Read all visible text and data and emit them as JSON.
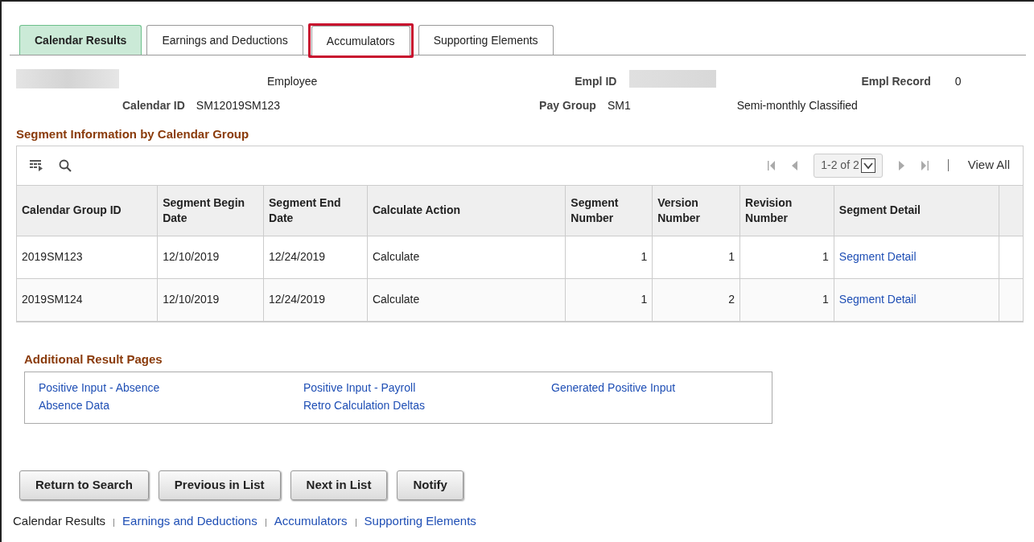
{
  "tabs": [
    {
      "label": "Calendar Results",
      "selected": true,
      "highlighted": false
    },
    {
      "label": "Earnings and Deductions",
      "selected": false,
      "highlighted": false
    },
    {
      "label": "Accumulators",
      "selected": false,
      "highlighted": true
    },
    {
      "label": "Supporting Elements",
      "selected": false,
      "highlighted": false
    }
  ],
  "header": {
    "employee_label": "Employee",
    "empl_id_label": "Empl ID",
    "empl_record_label": "Empl Record",
    "empl_record": "0",
    "calendar_id_label": "Calendar ID",
    "calendar_id": "SM12019SM123",
    "pay_group_label": "Pay Group",
    "pay_group": "SM1",
    "pay_group_description": "Semi-monthly Classified"
  },
  "segment_grid": {
    "title": "Segment Information by Calendar Group",
    "pager": "1-2 of 2",
    "view_all": "View All",
    "columns": [
      "Calendar Group ID",
      "Segment Begin Date",
      "Segment End Date",
      "Calculate Action",
      "Segment Number",
      "Version Number",
      "Revision Number",
      "Segment Detail"
    ],
    "rows": [
      {
        "cells": [
          "2019SM123",
          "12/10/2019",
          "12/24/2019",
          "Calculate",
          "1",
          "1",
          "1",
          "Segment Detail"
        ]
      },
      {
        "cells": [
          "2019SM124",
          "12/10/2019",
          "12/24/2019",
          "Calculate",
          "1",
          "2",
          "1",
          "Segment Detail"
        ]
      }
    ]
  },
  "additional_pages": {
    "title": "Additional Result Pages",
    "links": [
      [
        "Positive Input - Absence",
        "Absence Data"
      ],
      [
        "Positive Input - Payroll",
        "Retro Calculation Deltas"
      ],
      [
        "Generated Positive Input"
      ]
    ]
  },
  "buttons": [
    "Return to Search",
    "Previous in List",
    "Next in List",
    "Notify"
  ],
  "footer_links": [
    {
      "label": "Calendar Results",
      "selected": true
    },
    {
      "label": "Earnings and Deductions",
      "selected": false
    },
    {
      "label": "Accumulators",
      "selected": false
    },
    {
      "label": "Supporting Elements",
      "selected": false
    }
  ]
}
